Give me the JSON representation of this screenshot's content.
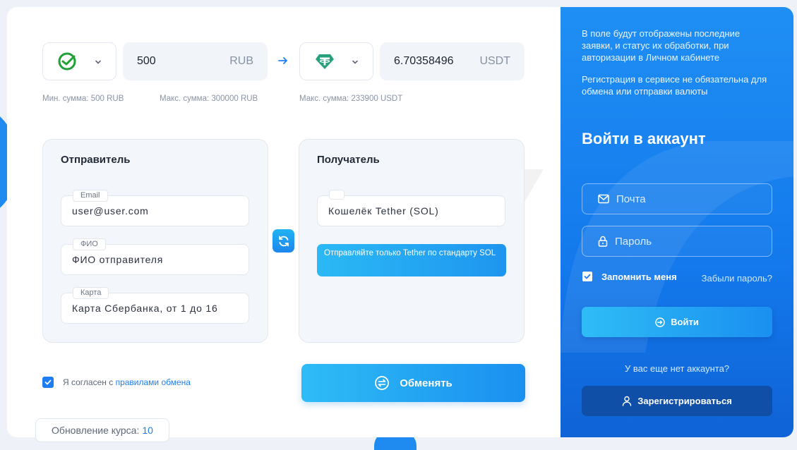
{
  "exchange": {
    "from": {
      "icon": "sber-icon",
      "amount": "500",
      "currency": "RUB",
      "min_limit": "Мин. сумма: 500 RUB",
      "max_limit": "Макс. сумма: 300000 RUB"
    },
    "to": {
      "icon": "tether-icon",
      "amount": "6.70358496",
      "currency": "USDT",
      "max_limit": "Макс. сумма: 233900 USDT"
    }
  },
  "sender": {
    "title": "Отправитель",
    "fields": [
      {
        "label": "Email",
        "value": "user@user.com"
      },
      {
        "label": "ФИО",
        "value": "ФИО отправителя"
      },
      {
        "label": "Карта",
        "value": "Карта Сбербанка, от 1 до 16"
      }
    ]
  },
  "receiver": {
    "title": "Получатель",
    "fields": [
      {
        "label": "",
        "value": "Кошелёк Tether (SOL)"
      }
    ],
    "notice": "Отправляйте только Tether по стандарту SOL"
  },
  "agreement": {
    "checked": true,
    "text": "Я согласен с ",
    "link": "правилами обмена"
  },
  "exchange_button": "Обменять",
  "rate_update": {
    "label": "Обновление курса:",
    "value": "10"
  },
  "side": {
    "info1": "В поле будут отображены последние заявки, и статус их обработки, при авторизации в Личном кабинете",
    "info2": "Регистрация в сервисе не обязательна для обмена или отправки валюты",
    "title": "Войти в аккаунт",
    "email_placeholder": "Почта",
    "password_placeholder": "Пароль",
    "remember": "Запомнить меня",
    "forgot": "Забыли пароль?",
    "login_button": "Войти",
    "no_account": "У вас еще нет аккаунта?",
    "register_button": "Зарегистрироваться"
  },
  "colors": {
    "accent": "#1e7ef0",
    "sber_green": "#21a038",
    "tether_green": "#26a17b",
    "side_bg": "#1379ec"
  }
}
